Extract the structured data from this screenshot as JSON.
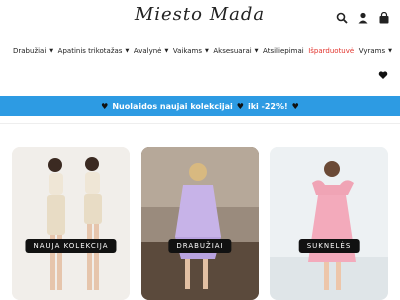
{
  "logo": "Miesto Mada",
  "header_icons": [
    "search-icon",
    "user-icon",
    "cart-icon"
  ],
  "nav": [
    {
      "label": "Drabužiai",
      "dropdown": true
    },
    {
      "label": "Apatinis trikotažas",
      "dropdown": true
    },
    {
      "label": "Avalynė",
      "dropdown": true
    },
    {
      "label": "Vaikams",
      "dropdown": true
    },
    {
      "label": "Aksesuarai",
      "dropdown": true
    },
    {
      "label": "Atsiliepimai",
      "dropdown": false
    },
    {
      "label": "Išparduotuvė",
      "dropdown": false
    },
    {
      "label": "Vyrams",
      "dropdown": true
    }
  ],
  "banner": {
    "part1": "Nuolaidos naujai kolekcijai",
    "part2": "iki -22%!"
  },
  "cards": [
    {
      "label": "NAUJA KOLEKCIJA"
    },
    {
      "label": "DRABUŽIAI"
    },
    {
      "label": "SUKNELĖS"
    }
  ],
  "colors": {
    "accent": "#2d9be3",
    "sale": "#e2342d",
    "button": "#111111"
  }
}
